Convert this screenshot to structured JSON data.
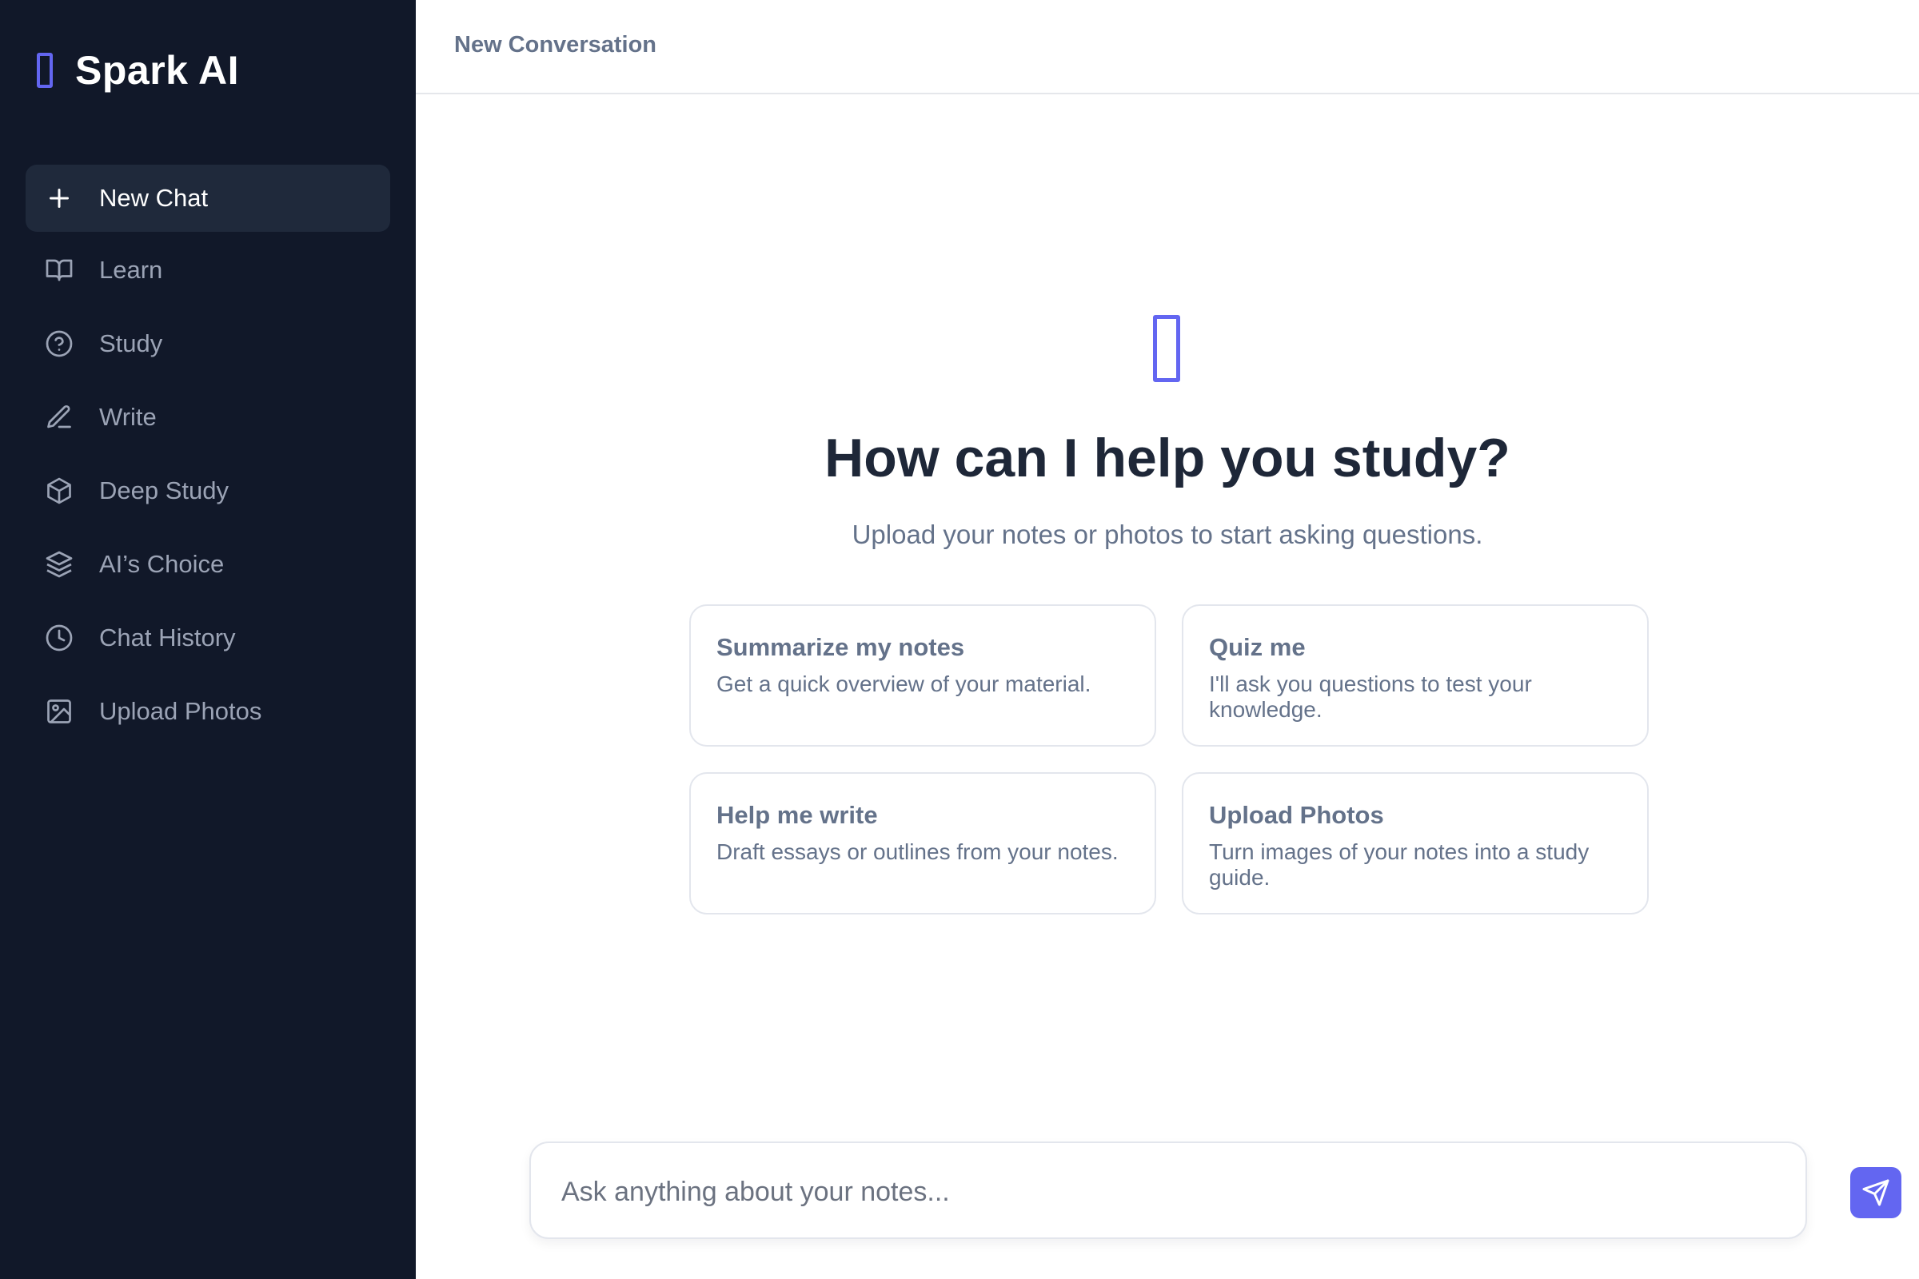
{
  "app": {
    "name": "Spark AI",
    "logo_icon": "spark-logo-icon"
  },
  "sidebar": {
    "items": [
      {
        "label": "New Chat",
        "icon": "plus-icon",
        "active": true
      },
      {
        "label": "Learn",
        "icon": "book-open-icon"
      },
      {
        "label": "Study",
        "icon": "help-circle-icon"
      },
      {
        "label": "Write",
        "icon": "pen-icon"
      },
      {
        "label": "Deep Study",
        "icon": "cube-icon"
      },
      {
        "label": "AI’s Choice",
        "icon": "layers-icon"
      },
      {
        "label": "Chat History",
        "icon": "clock-icon"
      },
      {
        "label": "Upload Photos",
        "icon": "image-icon"
      }
    ]
  },
  "header": {
    "title": "New Conversation"
  },
  "hero": {
    "icon": "spark-icon",
    "title": "How can I help you study?",
    "subtitle": "Upload your notes or photos to start asking questions."
  },
  "suggestions": [
    {
      "title": "Summarize my notes",
      "description": "Get a quick overview of your material."
    },
    {
      "title": "Quiz me",
      "description": "I'll ask you questions to test your knowledge."
    },
    {
      "title": "Help me write",
      "description": "Draft essays or outlines from your notes."
    },
    {
      "title": "Upload Photos",
      "description": "Turn images of your notes into a study guide."
    }
  ],
  "composer": {
    "placeholder": "Ask anything about your notes...",
    "value": "",
    "send_icon": "send-icon"
  },
  "colors": {
    "sidebar_bg": "#111829",
    "sidebar_active_bg": "#1f293b",
    "accent": "#6366f1",
    "heading": "#1e2738",
    "muted": "#64728a",
    "sidebar_text": "#9ba3b5",
    "border": "#e3e6ed"
  }
}
